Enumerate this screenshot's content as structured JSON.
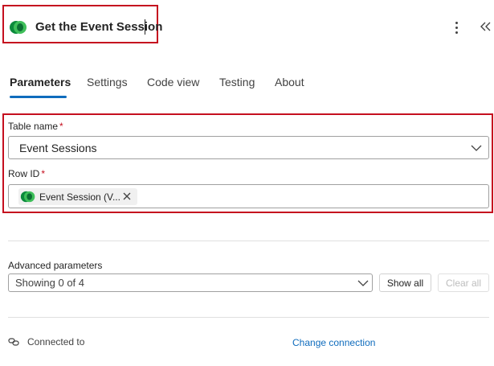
{
  "header": {
    "title": "Get the Event Session",
    "more_icon": "more-vertical-icon",
    "collapse_icon": "double-chevron-left-icon",
    "logo_icon": "dataverse-logo-icon"
  },
  "tabs": [
    {
      "label": "Parameters",
      "active": true
    },
    {
      "label": "Settings",
      "active": false
    },
    {
      "label": "Code view",
      "active": false
    },
    {
      "label": "Testing",
      "active": false
    },
    {
      "label": "About",
      "active": false
    }
  ],
  "parameters": {
    "table_name": {
      "label": "Table name",
      "required": "*",
      "value": "Event Sessions"
    },
    "row_id": {
      "label": "Row ID",
      "required": "*",
      "token": "Event Session (V..."
    }
  },
  "advanced": {
    "label": "Advanced parameters",
    "select_value": "Showing 0 of 4",
    "show_all": "Show all",
    "clear_all": "Clear all"
  },
  "connection": {
    "label": "Connected to",
    "change_link": "Change connection"
  },
  "colors": {
    "accent": "#0f6cbd",
    "highlight_border": "#c50f1f",
    "required": "#c50f1f"
  }
}
